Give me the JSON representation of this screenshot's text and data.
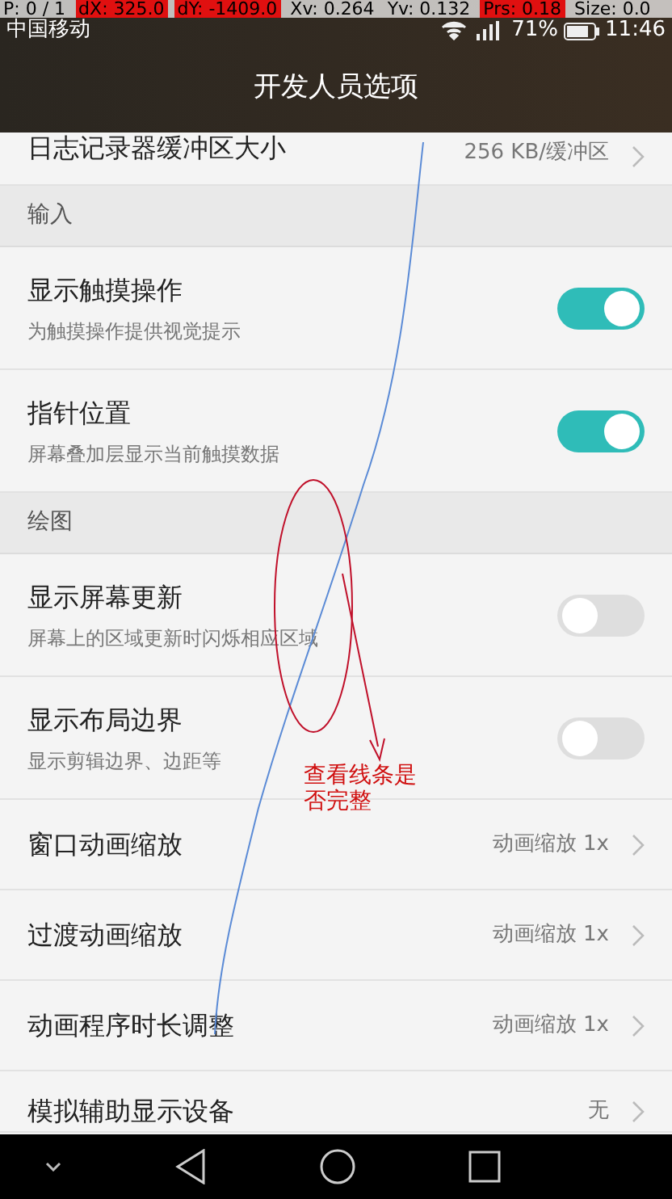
{
  "pointer_info": [
    {
      "text": "P: 0 / 1",
      "highlight": false
    },
    {
      "text": "dX: 325.0",
      "highlight": true
    },
    {
      "text": "dY: -1409.0",
      "highlight": true
    },
    {
      "text": "Xv: 0.264",
      "highlight": false
    },
    {
      "text": "Yv: 0.132",
      "highlight": false
    },
    {
      "text": "Prs: 0.18",
      "highlight": true
    },
    {
      "text": "Size: 0.0",
      "highlight": false
    }
  ],
  "status_bar": {
    "carrier": "中国移动",
    "battery": "71%",
    "time": "11:46"
  },
  "header": {
    "title": "开发人员选项"
  },
  "items": [
    {
      "kind": "link",
      "title": "日志记录器缓冲区大小",
      "value": "256 KB/缓冲区"
    },
    {
      "kind": "section",
      "title": "输入"
    },
    {
      "kind": "switch",
      "title": "显示触摸操作",
      "subtitle": "为触摸操作提供视觉提示",
      "on": true
    },
    {
      "kind": "switch",
      "title": "指针位置",
      "subtitle": "屏幕叠加层显示当前触摸数据",
      "on": true
    },
    {
      "kind": "section",
      "title": "绘图"
    },
    {
      "kind": "switch",
      "title": "显示屏幕更新",
      "subtitle": "屏幕上的区域更新时闪烁相应区域",
      "on": false
    },
    {
      "kind": "switch",
      "title": "显示布局边界",
      "subtitle": "显示剪辑边界、边距等",
      "on": false
    },
    {
      "kind": "link",
      "title": "窗口动画缩放",
      "value": "动画缩放 1x"
    },
    {
      "kind": "link",
      "title": "过渡动画缩放",
      "value": "动画缩放 1x"
    },
    {
      "kind": "link",
      "title": "动画程序时长调整",
      "value": "动画缩放 1x"
    },
    {
      "kind": "link",
      "title": "模拟辅助显示设备",
      "value": "无"
    }
  ],
  "annotation": {
    "text": "查看线条是否完整"
  }
}
